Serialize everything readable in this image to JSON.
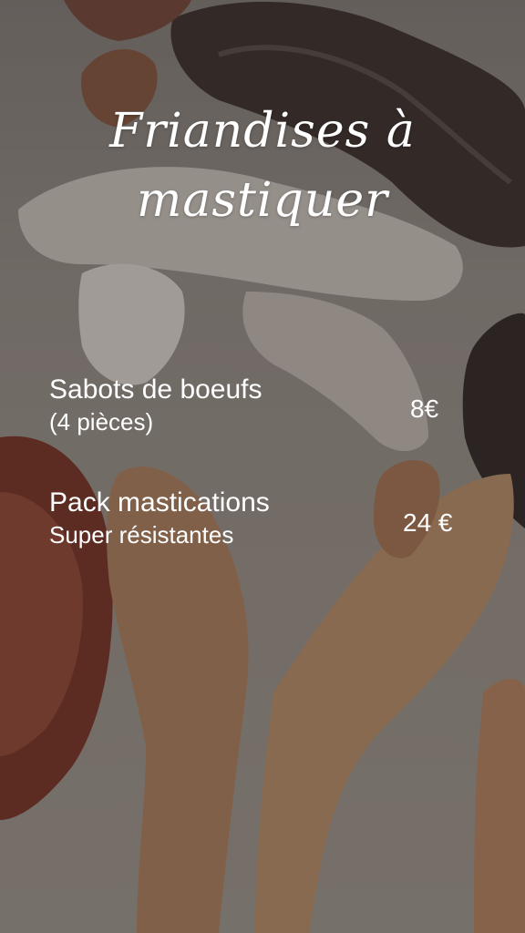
{
  "title": "Friandises à mastiquer",
  "items": [
    {
      "name": "Sabots de boeufs",
      "detail": "(4 pièces)",
      "price": "8€"
    },
    {
      "name": "Pack mastications",
      "detail": "Super résistantes",
      "price": "24 €"
    }
  ],
  "colors": {
    "text": "#ffffff",
    "overlay": "#28221f"
  }
}
